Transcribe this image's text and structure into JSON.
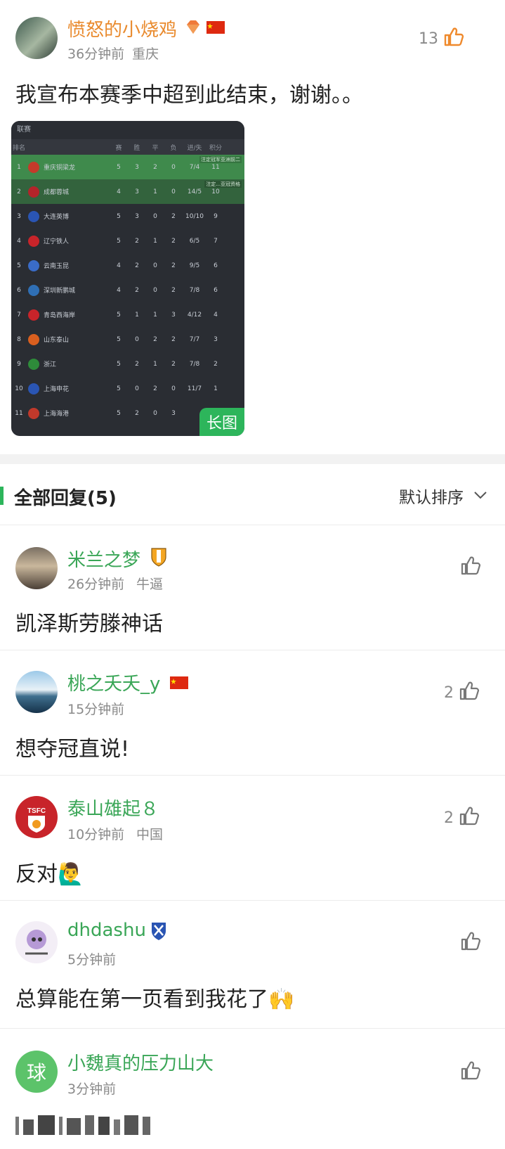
{
  "post": {
    "username": "愤怒的小烧鸡",
    "meta_time": "36分钟前",
    "meta_location": "重庆",
    "like_count": "13",
    "text": "我宣布本赛季中超到此结束，谢谢。。"
  },
  "standings_image": {
    "top_label": "联赛",
    "header": [
      "排名",
      "",
      "赛",
      "胜",
      "平",
      "负",
      "进/失",
      "积分"
    ],
    "rows": [
      {
        "rank": "1",
        "team": "重庆铜梁龙",
        "p": "5",
        "w": "3",
        "d": "2",
        "l": "0",
        "gd": "7/4",
        "pts": "11",
        "tag": "注定冠军亚洲前二"
      },
      {
        "rank": "2",
        "team": "成都蓉城",
        "p": "4",
        "w": "3",
        "d": "1",
        "l": "0",
        "gd": "14/5",
        "pts": "10",
        "tag": "注定...亚冠资格"
      },
      {
        "rank": "3",
        "team": "大连英博",
        "p": "5",
        "w": "3",
        "d": "0",
        "l": "2",
        "gd": "10/10",
        "pts": "9",
        "tag": ""
      },
      {
        "rank": "4",
        "team": "辽宁铁人",
        "p": "5",
        "w": "2",
        "d": "1",
        "l": "2",
        "gd": "6/5",
        "pts": "7",
        "tag": ""
      },
      {
        "rank": "5",
        "team": "云南玉昆",
        "p": "4",
        "w": "2",
        "d": "0",
        "l": "2",
        "gd": "9/5",
        "pts": "6",
        "tag": ""
      },
      {
        "rank": "6",
        "team": "深圳新鹏城",
        "p": "4",
        "w": "2",
        "d": "0",
        "l": "2",
        "gd": "7/8",
        "pts": "6",
        "tag": ""
      },
      {
        "rank": "7",
        "team": "青岛西海岸",
        "p": "5",
        "w": "1",
        "d": "1",
        "l": "3",
        "gd": "4/12",
        "pts": "4",
        "tag": ""
      },
      {
        "rank": "8",
        "team": "山东泰山",
        "p": "5",
        "w": "0",
        "d": "2",
        "l": "2",
        "gd": "7/7",
        "pts": "3",
        "tag": ""
      },
      {
        "rank": "9",
        "team": "浙江",
        "p": "5",
        "w": "2",
        "d": "1",
        "l": "2",
        "gd": "7/8",
        "pts": "2",
        "tag": ""
      },
      {
        "rank": "10",
        "team": "上海申花",
        "p": "5",
        "w": "0",
        "d": "2",
        "l": "0",
        "gd": "11/7",
        "pts": "1",
        "tag": ""
      },
      {
        "rank": "11",
        "team": "上海海港",
        "p": "5",
        "w": "2",
        "d": "0",
        "l": "3",
        "gd": "",
        "pts": "",
        "tag": ""
      }
    ],
    "badge": "长图"
  },
  "replies_header": {
    "title": "全部回复(5)",
    "sort_label": "默认排序"
  },
  "replies": [
    {
      "username": "米兰之梦",
      "time": "26分钟前",
      "location": "牛逼",
      "text": "凯泽斯劳滕神话",
      "likes": ""
    },
    {
      "username": "桃之夭夭_y",
      "time": "15分钟前",
      "location": "",
      "text": "想夺冠直说!",
      "likes": "2"
    },
    {
      "username": "泰山雄起８",
      "time": "10分钟前",
      "location": "中国",
      "text": "反对🙋‍♂️",
      "likes": "2"
    },
    {
      "username": "dhdashu",
      "time": "5分钟前",
      "location": "",
      "text": "总算能在第一页看到我花了🙌",
      "likes": ""
    },
    {
      "username": "小魏真的压力山大",
      "time": "3分钟前",
      "location": "",
      "text": "",
      "likes": "",
      "avatar_char": "球"
    }
  ],
  "colors": {
    "username_post": "#e98a2d",
    "username_reply": "#3aa657",
    "accent_green": "#2db55b"
  }
}
